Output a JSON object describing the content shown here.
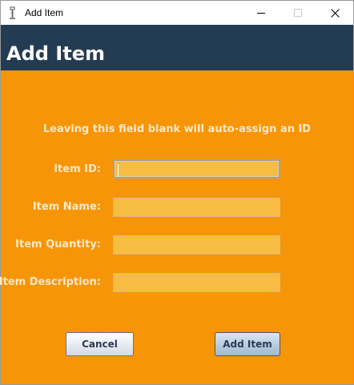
{
  "window": {
    "title": "Add Item",
    "icon": "java-cup-icon",
    "controls": [
      "minimize-icon",
      "maximize-icon",
      "close-icon"
    ]
  },
  "header": {
    "title": "Add Item",
    "background": "#243c53"
  },
  "form": {
    "hint": "Leaving this field blank will auto-assign an ID",
    "fields": [
      {
        "label": "Item ID:",
        "value": "",
        "focused": true
      },
      {
        "label": "Item Name:",
        "value": ""
      },
      {
        "label": "Item Quantity:",
        "value": ""
      },
      {
        "label": "Item Description:",
        "value": ""
      }
    ]
  },
  "buttons": {
    "cancel": "Cancel",
    "add": "Add Item"
  },
  "colors": {
    "background": "#f79508",
    "input_fill": "#f7bd42",
    "label_text": "#fbe9c8"
  }
}
